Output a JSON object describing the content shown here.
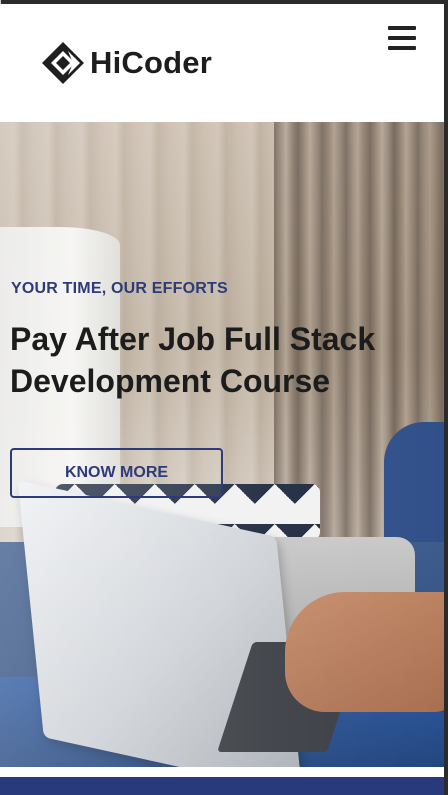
{
  "brand": {
    "name": "HiCoder",
    "logo_icon": "hicoder-logo-icon"
  },
  "header": {
    "menu_icon": "hamburger-menu-icon"
  },
  "hero": {
    "kicker": "YOUR TIME, OUR EFFORTS",
    "title": "Pay After Job Full Stack Development Course",
    "button_label": "KNOW MORE"
  },
  "colors": {
    "accent": "#2e3b7a",
    "footer_band": "#283a7c",
    "text_dark": "#1c1c1c"
  }
}
